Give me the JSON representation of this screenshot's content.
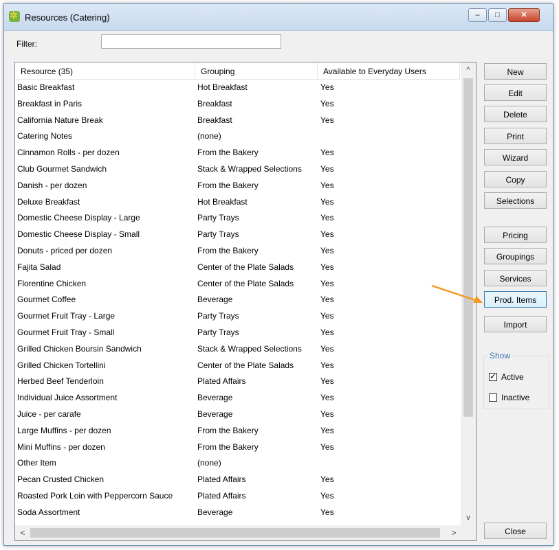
{
  "window": {
    "title": "Resources (Catering)",
    "controls": {
      "minimize": "–",
      "maximize": "□",
      "close": "✕"
    }
  },
  "filter": {
    "label": "Filter:",
    "value": ""
  },
  "table": {
    "columns": [
      "Resource (35)",
      "Grouping",
      "Available to Everyday Users"
    ],
    "rows": [
      [
        "Basic Breakfast",
        "Hot Breakfast",
        "Yes"
      ],
      [
        "Breakfast in Paris",
        "Breakfast",
        "Yes"
      ],
      [
        "California Nature Break",
        "Breakfast",
        "Yes"
      ],
      [
        "Catering Notes",
        "(none)",
        ""
      ],
      [
        "Cinnamon Rolls - per dozen",
        "From the Bakery",
        "Yes"
      ],
      [
        "Club Gourmet Sandwich",
        "Stack & Wrapped Selections",
        "Yes"
      ],
      [
        "Danish - per dozen",
        "From the Bakery",
        "Yes"
      ],
      [
        "Deluxe Breakfast",
        "Hot Breakfast",
        "Yes"
      ],
      [
        "Domestic Cheese Display - Large",
        "Party Trays",
        "Yes"
      ],
      [
        "Domestic Cheese Display - Small",
        "Party Trays",
        "Yes"
      ],
      [
        "Donuts - priced per dozen",
        "From the Bakery",
        "Yes"
      ],
      [
        "Fajita Salad",
        "Center of the Plate Salads",
        "Yes"
      ],
      [
        "Florentine Chicken",
        "Center of the Plate Salads",
        "Yes"
      ],
      [
        "Gourmet Coffee",
        "Beverage",
        "Yes"
      ],
      [
        "Gourmet Fruit Tray - Large",
        "Party Trays",
        "Yes"
      ],
      [
        "Gourmet Fruit Tray - Small",
        "Party Trays",
        "Yes"
      ],
      [
        "Grilled Chicken Boursin Sandwich",
        "Stack & Wrapped Selections",
        "Yes"
      ],
      [
        "Grilled Chicken Tortellini",
        "Center of the Plate Salads",
        "Yes"
      ],
      [
        "Herbed Beef Tenderloin",
        "Plated Affairs",
        "Yes"
      ],
      [
        "Individual Juice Assortment",
        "Beverage",
        "Yes"
      ],
      [
        "Juice - per carafe",
        "Beverage",
        "Yes"
      ],
      [
        "Large Muffins - per dozen",
        "From the Bakery",
        "Yes"
      ],
      [
        "Mini Muffins - per dozen",
        "From the Bakery",
        "Yes"
      ],
      [
        "Other Item",
        "(none)",
        ""
      ],
      [
        "Pecan Crusted Chicken",
        "Plated Affairs",
        "Yes"
      ],
      [
        "Roasted Pork Loin with Peppercorn Sauce",
        "Plated Affairs",
        "Yes"
      ],
      [
        "Soda Assortment",
        "Beverage",
        "Yes"
      ]
    ]
  },
  "scroll": {
    "up": "^",
    "down": "v",
    "left": "<",
    "right": ">"
  },
  "buttons": {
    "new": "New",
    "edit": "Edit",
    "delete": "Delete",
    "print": "Print",
    "wizard": "Wizard",
    "copy": "Copy",
    "selections": "Selections",
    "pricing": "Pricing",
    "groupings": "Groupings",
    "services": "Services",
    "prod_items": "Prod. Items",
    "import": "Import",
    "close": "Close"
  },
  "show": {
    "legend": "Show",
    "active": "Active",
    "inactive": "Inactive",
    "active_checked": true,
    "inactive_checked": false
  },
  "colors": {
    "annotation_arrow": "#f39a21",
    "accent": "#3c78b5"
  }
}
